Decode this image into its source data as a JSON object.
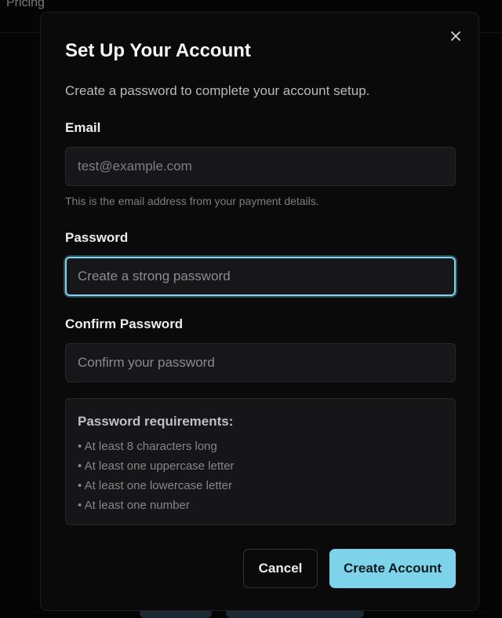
{
  "background": {
    "nav_link": "Pricing"
  },
  "modal": {
    "title": "Set Up Your Account",
    "description": "Create a password to complete your account setup.",
    "close_icon": "close-icon",
    "email": {
      "label": "Email",
      "value": "",
      "placeholder": "test@example.com",
      "hint": "This is the email address from your payment details."
    },
    "password": {
      "label": "Password",
      "value": "",
      "placeholder": "Create a strong password"
    },
    "confirm_password": {
      "label": "Confirm Password",
      "value": "",
      "placeholder": "Confirm your password"
    },
    "requirements": {
      "title": "Password requirements:",
      "items": [
        "• At least 8 characters long",
        "• At least one uppercase letter",
        "• At least one lowercase letter",
        "• At least one number"
      ]
    },
    "buttons": {
      "cancel": "Cancel",
      "create": "Create Account"
    }
  },
  "colors": {
    "accent": "#7dd3ea",
    "focus_ring": "#7fd4ea",
    "modal_bg": "#0a0a0b",
    "field_bg": "#17171a"
  }
}
